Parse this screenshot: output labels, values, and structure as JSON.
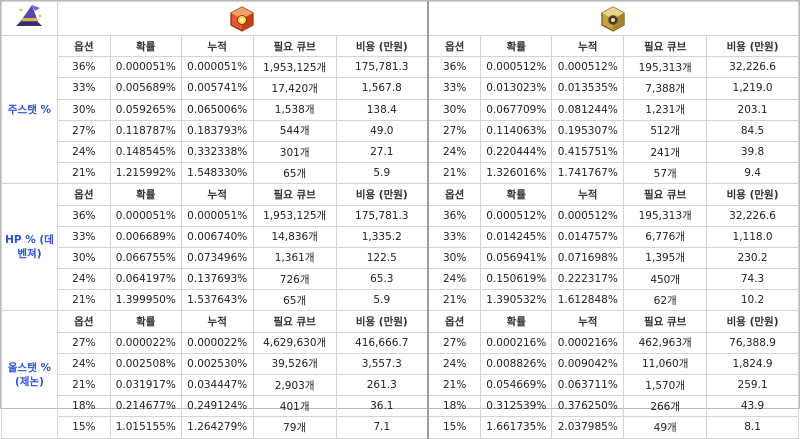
{
  "icons": {
    "corner": "wizard-hat-icon",
    "left_header": "red-cube-icon",
    "right_header": "gold-cube-icon"
  },
  "colors": {
    "label": "#2f50d8",
    "red_cube": "#e05a2b",
    "gold_cube": "#c7a23a"
  },
  "columns": [
    "옵션",
    "확률",
    "누적",
    "필요 큐브",
    "비용 (만원)"
  ],
  "sections": [
    {
      "label": "주스탯 %",
      "left": [
        [
          "36%",
          "0.000051%",
          "0.000051%",
          "1,953,125개",
          "175,781.3"
        ],
        [
          "33%",
          "0.005689%",
          "0.005741%",
          "17,420개",
          "1,567.8"
        ],
        [
          "30%",
          "0.059265%",
          "0.065006%",
          "1,538개",
          "138.4"
        ],
        [
          "27%",
          "0.118787%",
          "0.183793%",
          "544개",
          "49.0"
        ],
        [
          "24%",
          "0.148545%",
          "0.332338%",
          "301개",
          "27.1"
        ],
        [
          "21%",
          "1.215992%",
          "1.548330%",
          "65개",
          "5.9"
        ]
      ],
      "right": [
        [
          "36%",
          "0.000512%",
          "0.000512%",
          "195,313개",
          "32,226.6"
        ],
        [
          "33%",
          "0.013023%",
          "0.013535%",
          "7,388개",
          "1,219.0"
        ],
        [
          "30%",
          "0.067709%",
          "0.081244%",
          "1,231개",
          "203.1"
        ],
        [
          "27%",
          "0.114063%",
          "0.195307%",
          "512개",
          "84.5"
        ],
        [
          "24%",
          "0.220444%",
          "0.415751%",
          "241개",
          "39.8"
        ],
        [
          "21%",
          "1.326016%",
          "1.741767%",
          "57개",
          "9.4"
        ]
      ]
    },
    {
      "label": "HP % (데벤져)",
      "left": [
        [
          "36%",
          "0.000051%",
          "0.000051%",
          "1,953,125개",
          "175,781.3"
        ],
        [
          "33%",
          "0.006689%",
          "0.006740%",
          "14,836개",
          "1,335.2"
        ],
        [
          "30%",
          "0.066755%",
          "0.073496%",
          "1,361개",
          "122.5"
        ],
        [
          "24%",
          "0.064197%",
          "0.137693%",
          "726개",
          "65.3"
        ],
        [
          "21%",
          "1.399950%",
          "1.537643%",
          "65개",
          "5.9"
        ]
      ],
      "right": [
        [
          "36%",
          "0.000512%",
          "0.000512%",
          "195,313개",
          "32,226.6"
        ],
        [
          "33%",
          "0.014245%",
          "0.014757%",
          "6,776개",
          "1,118.0"
        ],
        [
          "30%",
          "0.056941%",
          "0.071698%",
          "1,395개",
          "230.2"
        ],
        [
          "24%",
          "0.150619%",
          "0.222317%",
          "450개",
          "74.3"
        ],
        [
          "21%",
          "1.390532%",
          "1.612848%",
          "62개",
          "10.2"
        ]
      ]
    },
    {
      "label": "올스탯 % (제논)",
      "left": [
        [
          "27%",
          "0.000022%",
          "0.000022%",
          "4,629,630개",
          "416,666.7"
        ],
        [
          "24%",
          "0.002508%",
          "0.002530%",
          "39,526개",
          "3,557.3"
        ],
        [
          "21%",
          "0.031917%",
          "0.034447%",
          "2,903개",
          "261.3"
        ],
        [
          "18%",
          "0.214677%",
          "0.249124%",
          "401개",
          "36.1"
        ],
        [
          "15%",
          "1.015155%",
          "1.264279%",
          "79개",
          "7.1"
        ]
      ],
      "right": [
        [
          "27%",
          "0.000216%",
          "0.000216%",
          "462,963개",
          "76,388.9"
        ],
        [
          "24%",
          "0.008826%",
          "0.009042%",
          "11,060개",
          "1,824.9"
        ],
        [
          "21%",
          "0.054669%",
          "0.063711%",
          "1,570개",
          "259.1"
        ],
        [
          "18%",
          "0.312539%",
          "0.376250%",
          "266개",
          "43.9"
        ],
        [
          "15%",
          "1.661735%",
          "2.037985%",
          "49개",
          "8.1"
        ]
      ]
    }
  ]
}
